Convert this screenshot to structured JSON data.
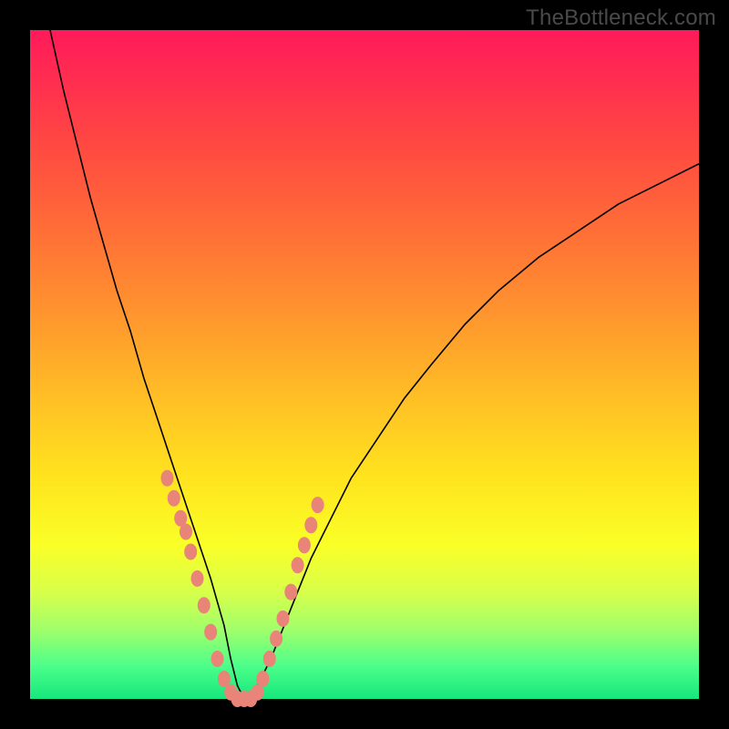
{
  "watermark": {
    "text": "TheBottleneck.com"
  },
  "chart_data": {
    "type": "line",
    "title": "",
    "xlabel": "",
    "ylabel": "",
    "xlim": [
      0,
      100
    ],
    "ylim": [
      0,
      100
    ],
    "grid": false,
    "legend": "none",
    "gradient_note": "background encodes bottleneck %: top=red (high), bottom=green (0)",
    "series": [
      {
        "name": "bottleneck-curve",
        "x": [
          3,
          5,
          7,
          9,
          11,
          13,
          15,
          17,
          19,
          21,
          23,
          25,
          27,
          29,
          30,
          31,
          32,
          33,
          34,
          36,
          38,
          40,
          42,
          45,
          48,
          52,
          56,
          60,
          65,
          70,
          76,
          82,
          88,
          94,
          100
        ],
        "y": [
          100,
          91,
          83,
          75,
          68,
          61,
          55,
          48,
          42,
          36,
          30,
          24,
          18,
          11,
          6,
          2,
          0,
          0,
          2,
          6,
          11,
          16,
          21,
          27,
          33,
          39,
          45,
          50,
          56,
          61,
          66,
          70,
          74,
          77,
          80
        ]
      }
    ],
    "markers": {
      "name": "highlight-points",
      "color": "#e88478",
      "x": [
        20.5,
        21.5,
        22.5,
        23.3,
        24.0,
        25.0,
        26.0,
        27.0,
        28.0,
        29.0,
        30.0,
        31.0,
        32.0,
        33.0,
        34.0,
        34.8,
        35.8,
        36.8,
        37.8,
        39.0,
        40.0,
        41.0,
        42.0,
        43.0
      ],
      "y": [
        33,
        30,
        27,
        25,
        22,
        18,
        14,
        10,
        6,
        3,
        1,
        0,
        0,
        0,
        1,
        3,
        6,
        9,
        12,
        16,
        20,
        23,
        26,
        29
      ]
    }
  }
}
